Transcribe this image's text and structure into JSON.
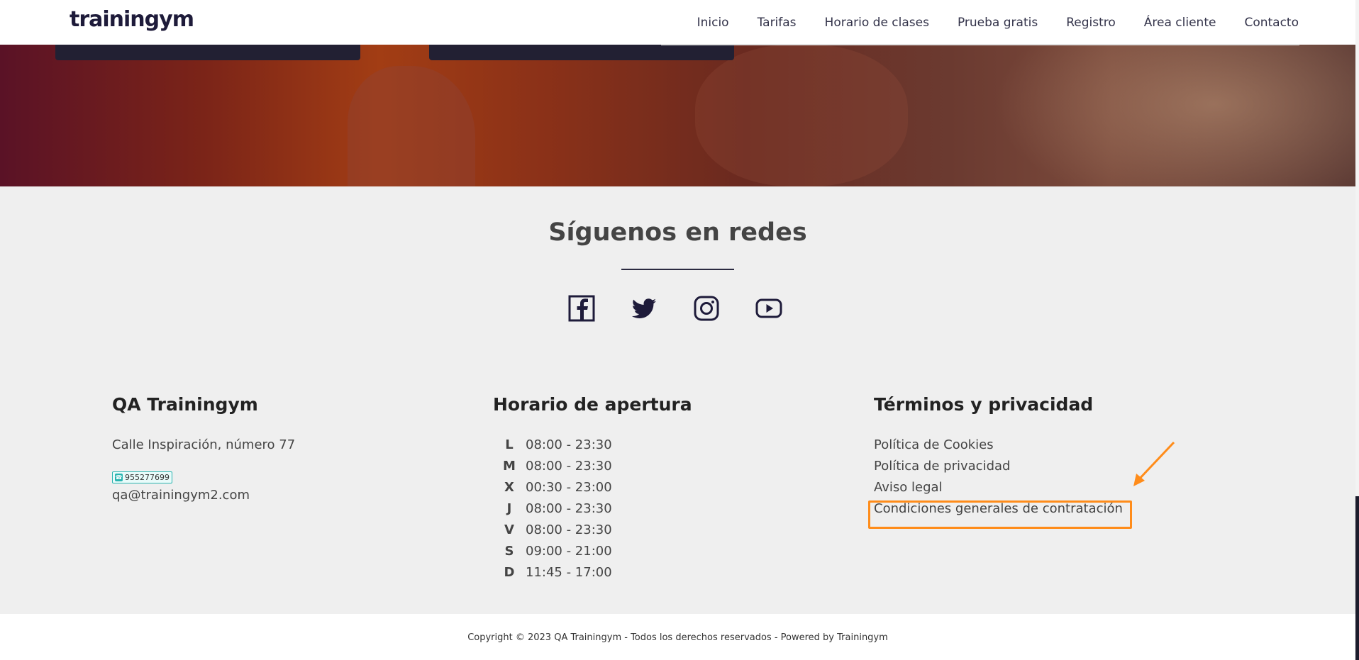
{
  "header": {
    "logo": "trainingym",
    "nav": [
      "Inicio",
      "Tarifas",
      "Horario de clases",
      "Prueba gratis",
      "Registro",
      "Área cliente",
      "Contacto"
    ]
  },
  "social": {
    "title": "Síguenos en redes",
    "icons": [
      "facebook-icon",
      "twitter-icon",
      "instagram-icon",
      "youtube-icon"
    ]
  },
  "contact": {
    "title": "QA Trainingym",
    "address": "Calle Inspiración, número 77",
    "phone": "955277699",
    "email": "qa@trainingym2.com"
  },
  "hours": {
    "title": "Horario de apertura",
    "rows": [
      {
        "day": "L",
        "time": "08:00 - 23:30"
      },
      {
        "day": "M",
        "time": "08:00 - 23:30"
      },
      {
        "day": "X",
        "time": "00:30 - 23:00"
      },
      {
        "day": "J",
        "time": "08:00 - 23:30"
      },
      {
        "day": "V",
        "time": "08:00 - 23:30"
      },
      {
        "day": "S",
        "time": "09:00 - 21:00"
      },
      {
        "day": "D",
        "time": "11:45 - 17:00"
      }
    ]
  },
  "terms": {
    "title": "Términos y privacidad",
    "links": [
      "Política de Cookies",
      "Política de privacidad",
      "Aviso legal",
      "Condiciones generales de contratación"
    ]
  },
  "footer": {
    "copyright": "Copyright © 2023 QA Trainingym - Todos los derechos reservados - Powered by Trainingym"
  },
  "colors": {
    "accent": "#ff8c1a",
    "dark": "#1e1b3a",
    "phone_badge": "#29b4b0"
  }
}
